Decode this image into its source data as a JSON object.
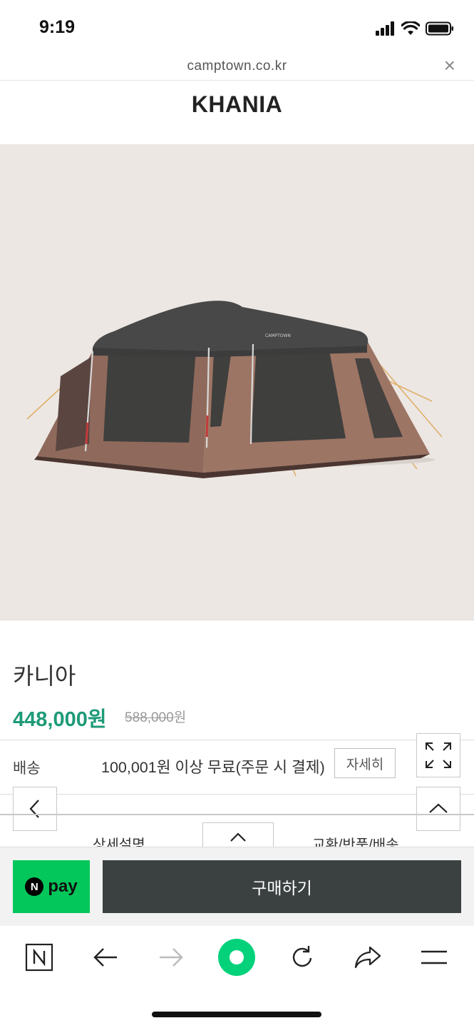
{
  "status_bar": {
    "time": "9:19"
  },
  "browser": {
    "url": "camptown.co.kr",
    "close_icon": "close-icon"
  },
  "site": {
    "title": "KHANIA"
  },
  "product": {
    "name": "카니아",
    "price": "448,000원",
    "original_price_number": "588,000",
    "original_price_unit": "원",
    "image_icon": "tent-image",
    "image_brand_text": "CAMPTOWN"
  },
  "shipping": {
    "label": "배송",
    "text": "100,001원 이상 무료(주문 시 결제)",
    "detail_button": "자세히"
  },
  "tabs": [
    {
      "label": "상세설명"
    },
    {
      "label": "교환/반품/배송"
    }
  ],
  "buy_bar": {
    "npay_circle": "N",
    "npay_text": "pay",
    "buy_label": "구매하기"
  },
  "colors": {
    "price_accent": "#1e9a78",
    "npay_green": "#03c75a",
    "buy_button": "#3b4141",
    "nav_green": "#03d27b"
  }
}
